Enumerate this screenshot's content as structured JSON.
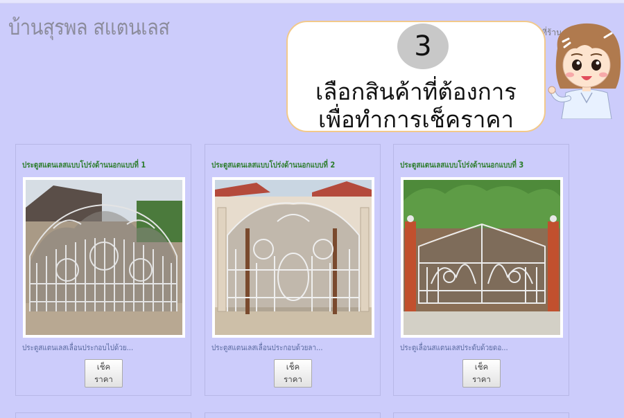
{
  "header": {
    "site_title": "บ้านสุรพล สแตนเลส",
    "nav_fragment": "ยที่ร้าน"
  },
  "callout": {
    "step_number": "3",
    "line1": "เลือกสินค้าที่ต้องการ",
    "line2": "เพื่อทำการเช็คราคา"
  },
  "products": [
    {
      "title": "ประตูสแตนเลสแบบโปร่งด้านนอกแบบที่ 1",
      "description": "ประตูสแตนเลสเลื่อนประกอบไปด้วย...",
      "button_label": "เช็คราคา"
    },
    {
      "title": "ประตูสแตนเลสแบบโปร่งด้านนอกแบบที่ 2",
      "description": "ประตูสแตนเลสเลื่อนประกอบด้วยลา...",
      "button_label": "เช็คราคา"
    },
    {
      "title": "ประตูสแตนเลสแบบโปร่งด้านนอกแบบที่ 3",
      "description": "ประตูเลื่อนสแตนเลสประดับด้วยดอ...",
      "button_label": "เช็คราคา"
    }
  ],
  "colors": {
    "page_background": "#ccccfb",
    "product_title": "#2d7d2d",
    "callout_border": "#f2c98a"
  }
}
